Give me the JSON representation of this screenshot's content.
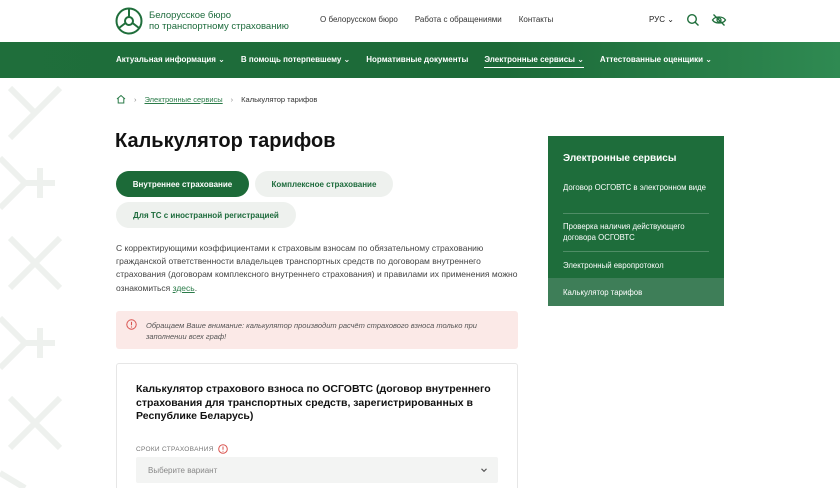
{
  "header": {
    "logo_line1": "Белорусское бюро",
    "logo_line2": "по транспортному страхованию",
    "links": [
      "О белорусском бюро",
      "Работа с обращениями",
      "Контакты"
    ],
    "lang": "РУС ⌄",
    "search_icon": "search-icon",
    "accessibility_icon": "eye-slash-icon"
  },
  "nav": {
    "items": [
      {
        "label": "Актуальная информация ⌄"
      },
      {
        "label": "В помощь потерпевшему ⌄"
      },
      {
        "label": "Нормативные документы"
      },
      {
        "label": "Электронные сервисы ⌄"
      },
      {
        "label": "Аттестованные оценщики ⌄"
      }
    ]
  },
  "breadcrumb": {
    "home_icon": "home-icon",
    "link": "Электронные сервисы",
    "current": "Калькулятор тарифов"
  },
  "page_title": "Калькулятор тарифов",
  "tabs": [
    "Внутреннее страхование",
    "Комплексное страхование",
    "Для ТС с иностранной регистрацией"
  ],
  "intro": {
    "text": "С корректирующими коэффициентами к страховым взносам по обязательному страхованию гражданской ответственности владельцев транспортных средств по договорам внутреннего страхования (договорам комплексного внутреннего страхования) и правилами их применения можно ознакомиться",
    "link": "здесь",
    "end": "."
  },
  "alert": {
    "text": "Обращаем Ваше внимание: калькулятор производит расчёт страхового взноса только при заполнении всех граф!"
  },
  "calculator": {
    "title": "Калькулятор страхового взноса по ОСГОВТС (договор внутреннего страхования для транспортных средств, зарегистрированных в Республике Беларусь)",
    "field_label": "СРОКИ СТРАХОВАНИЯ",
    "select_placeholder": "Выберите вариант"
  },
  "sidebar": {
    "title": "Электронные сервисы",
    "items": [
      {
        "label": "Договор ОСГОВТС в электронном виде"
      },
      {
        "label": "Проверка наличия действующего договора ОСГОВТС"
      },
      {
        "label": "Электронный европротокол"
      },
      {
        "label": "Калькулятор тарифов"
      }
    ]
  }
}
